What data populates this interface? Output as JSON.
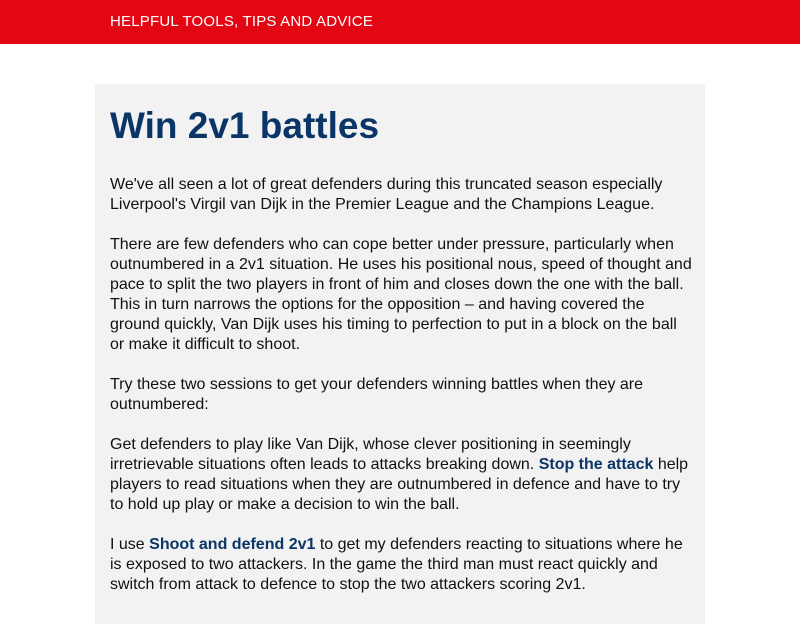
{
  "header": {
    "tagline": "HELPFUL TOOLS, TIPS AND ADVICE"
  },
  "article": {
    "title": "Win 2v1 battles",
    "p1": "We've all seen a lot of great defenders during this truncated season especially Liverpool's Virgil van Dijk in the Premier League and the Champions League.",
    "p2": "There are few defenders who can cope better under pressure, particularly when outnumbered in a 2v1 situation. He uses his positional nous, speed of thought and pace to split the two players in front of him and closes down the one with the ball. This in turn narrows the options for the opposition – and having covered the ground quickly, Van Dijk uses his timing to perfection to put in a block on the ball or make it difficult to shoot.",
    "p3": "Try these two sessions to get your defenders winning battles when they are outnumbered:",
    "p4_before": "Get defenders to play like Van Dijk, whose clever positioning in seemingly irretrievable situations often leads to attacks breaking down. ",
    "p4_link": "Stop the attack",
    "p4_after": " help players to read situations when they are outnumbered in defence and have to try to hold up play or make a decision to win the ball.",
    "p5_before": "I use ",
    "p5_link": "Shoot and defend 2v1",
    "p5_after": " to get my defenders reacting to situations where he is exposed to two attackers. In the game the third man must react quickly and switch from attack to defence to stop the two attackers scoring 2v1."
  },
  "colors": {
    "header_bg": "#e30613",
    "card_bg": "#f3f2f3",
    "title": "#0a3566",
    "link": "#0a3566"
  }
}
